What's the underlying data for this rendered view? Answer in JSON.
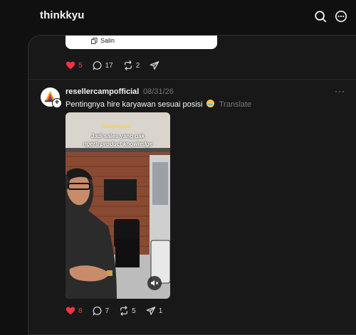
{
  "app": {
    "title": "thinkkyu"
  },
  "prev_post": {
    "copy_label": "Salin",
    "likes": "5",
    "comments": "17",
    "reposts": "2"
  },
  "post": {
    "username": "resellercampofficial",
    "timestamp": "08/31/26",
    "more": "···",
    "text": "Pentingnya hire karyawan sesuai posisi",
    "translate": "Translate",
    "video": {
      "caption_line1": "Jadi sales yang gak",
      "caption_line2": "ngerti product knowledge",
      "brand": "ResellerCamp"
    },
    "likes": "8",
    "comments": "7",
    "reposts": "5",
    "shares": "1"
  },
  "colors": {
    "background": "#101010",
    "card": "#181818",
    "like": "#ff3040",
    "muted": "#777777"
  }
}
